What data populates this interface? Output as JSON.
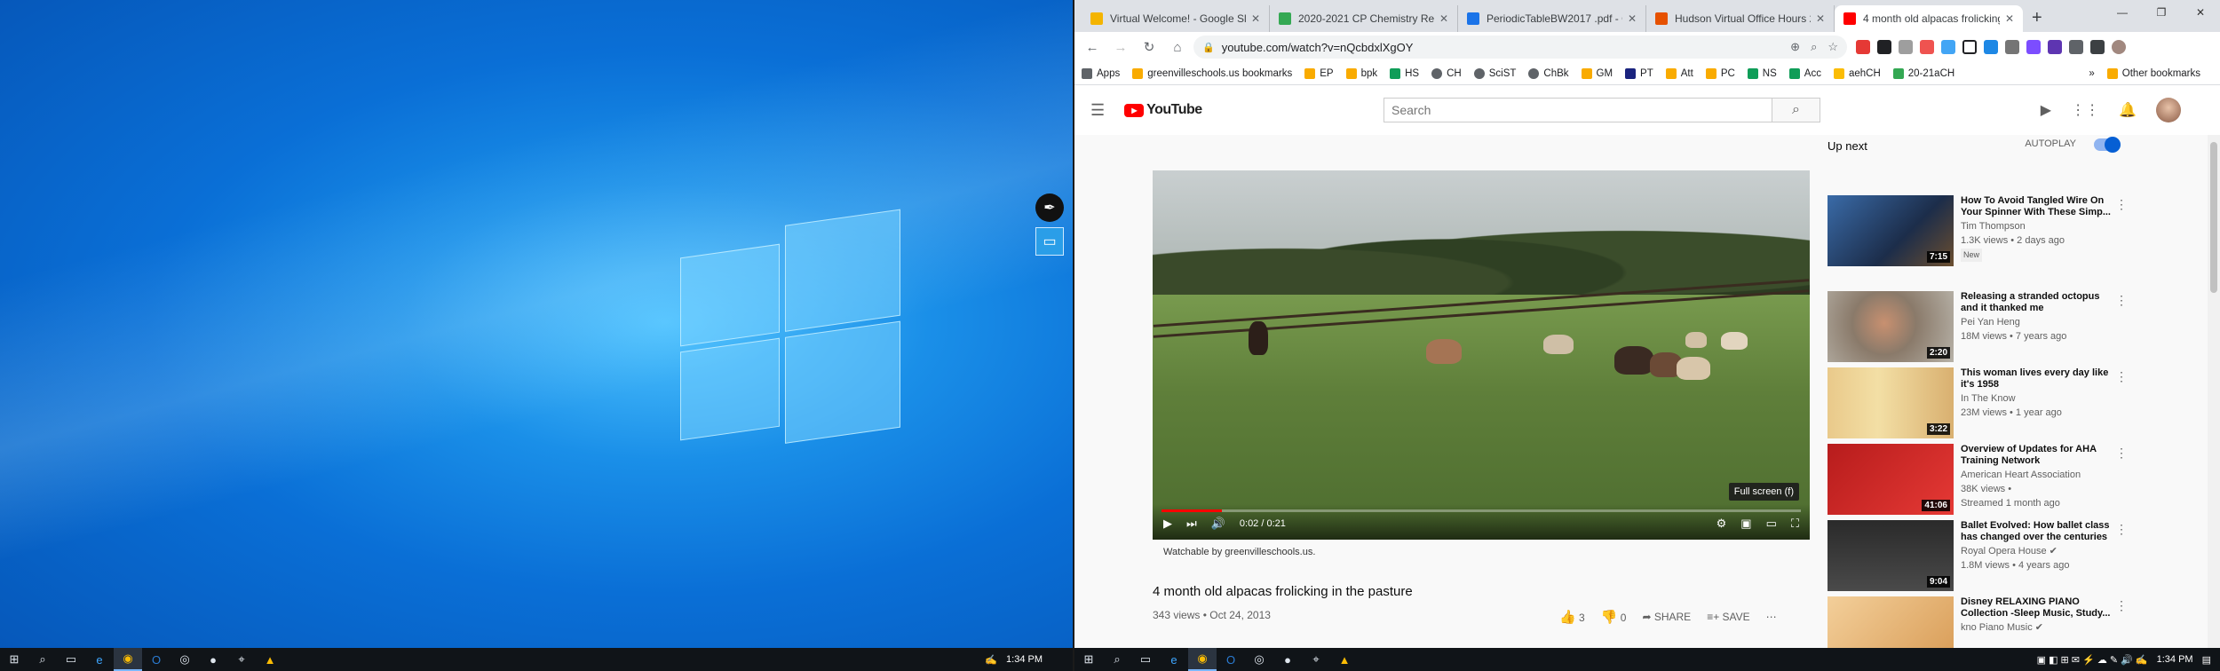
{
  "left_taskbar": {
    "time": "1:34 PM"
  },
  "right_taskbar": {
    "time": "1:34 PM"
  },
  "browser": {
    "tabs": [
      {
        "title": "Virtual Welcome! - Google Sli",
        "color": "#f4b400"
      },
      {
        "title": "2020-2021 CP Chemistry Refe",
        "color": "#34a853"
      },
      {
        "title": "PeriodicTableBW2017 .pdf - Go",
        "color": "#1a73e8"
      },
      {
        "title": "Hudson Virtual Office Hours 2",
        "color": "#e65100"
      },
      {
        "title": "4 month old alpacas frolicking",
        "color": "#ff0000"
      }
    ],
    "new_tab": "+",
    "url": "youtube.com/watch?v=nQcbdxlXgOY",
    "bookmarks": [
      {
        "label": "Apps",
        "color": "#5f6368"
      },
      {
        "label": "greenvilleschools.us bookmarks",
        "color": "#f9ab00"
      },
      {
        "label": "EP",
        "color": "#f9ab00"
      },
      {
        "label": "bpk",
        "color": "#f9ab00"
      },
      {
        "label": "HS",
        "color": "#0f9d58"
      },
      {
        "label": "CH",
        "color": "#5f6368"
      },
      {
        "label": "SciST",
        "color": "#5f6368"
      },
      {
        "label": "ChBk",
        "color": "#5f6368"
      },
      {
        "label": "GM",
        "color": "#f9ab00"
      },
      {
        "label": "PT",
        "color": "#1a237e"
      },
      {
        "label": "Att",
        "color": "#f9ab00"
      },
      {
        "label": "PC",
        "color": "#f9ab00"
      },
      {
        "label": "NS",
        "color": "#0f9d58"
      },
      {
        "label": "Acc",
        "color": "#0f9d58"
      },
      {
        "label": "aehCH",
        "color": "#fbbc04"
      },
      {
        "label": "20-21aCH",
        "color": "#34a853"
      }
    ],
    "more_bookmarks": "»",
    "other_bookmarks": "Other bookmarks"
  },
  "youtube": {
    "logo": "YouTube",
    "search_placeholder": "Search",
    "video": {
      "title": "4 month old alpacas frolicking in the pasture",
      "views_date": "343 views • Oct 24, 2013",
      "time": "0:02 / 0:21",
      "progress": 0.095,
      "tooltip": "Full screen (f)",
      "watchable": "Watchable by greenvilleschools.us.",
      "likes": "3",
      "dislikes": "0",
      "share": "SHARE",
      "save": "SAVE"
    },
    "up_next": "Up next",
    "autoplay": "AUTOPLAY",
    "sidebar": [
      {
        "title": "How To Avoid Tangled Wire On Your Spinner With These Simp...",
        "channel": "Tim Thompson",
        "views": "1.3K views • 2 days ago",
        "badge": "New",
        "duration": "7:15"
      },
      {
        "title": "Releasing a stranded octopus and it thanked me",
        "channel": "Pei Yan Heng",
        "views": "18M views • 7 years ago",
        "badge": "",
        "duration": "2:20"
      },
      {
        "title": "This woman lives every day like it's 1958",
        "channel": "In The Know",
        "views": "23M views • 1 year ago",
        "badge": "",
        "duration": "3:22"
      },
      {
        "title": "Overview of Updates for AHA Training Network",
        "channel": "American Heart Association",
        "views": "38K views •",
        "views2": "Streamed 1 month ago",
        "badge": "",
        "duration": "41:06"
      },
      {
        "title": "Ballet Evolved: How ballet class has changed over the centuries",
        "channel": "Royal Opera House ✔",
        "views": "1.8M views • 4 years ago",
        "badge": "",
        "duration": "9:04"
      },
      {
        "title": "Disney RELAXING PIANO Collection -Sleep Music, Study...",
        "channel": "kno Piano Music ✔",
        "views": "",
        "badge": "",
        "duration": ""
      }
    ]
  }
}
